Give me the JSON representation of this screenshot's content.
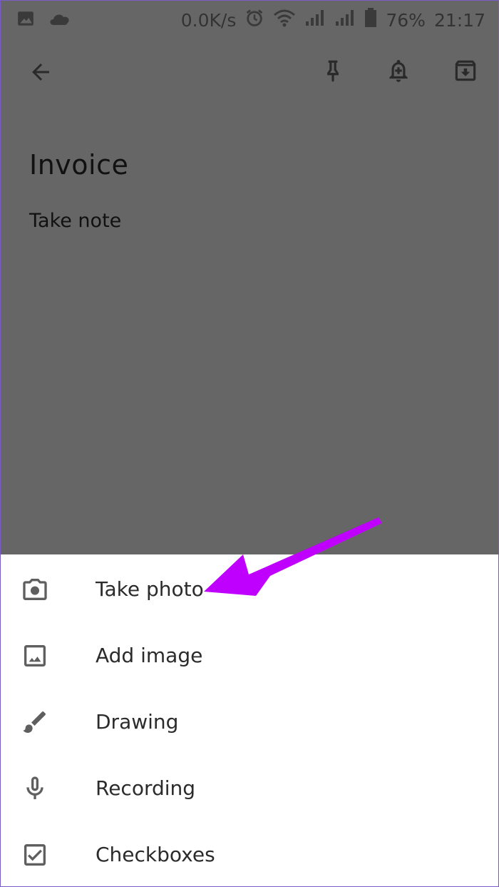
{
  "status_bar": {
    "network_speed": "0.0K/s",
    "battery": "76%",
    "time": "21:17",
    "icons": [
      "image-icon",
      "cloud-icon",
      "alarm-icon",
      "wifi-icon",
      "signal-icon",
      "signal-icon-2",
      "battery-icon"
    ]
  },
  "app_bar": {
    "icons": [
      "back-arrow-icon",
      "pin-icon",
      "reminder-bell-icon",
      "archive-icon"
    ]
  },
  "note": {
    "title": "Invoice",
    "body_placeholder": "Take note"
  },
  "add_menu": {
    "items": [
      {
        "label": "Take photo",
        "icon": "camera-icon"
      },
      {
        "label": "Add image",
        "icon": "image-icon"
      },
      {
        "label": "Drawing",
        "icon": "brush-icon"
      },
      {
        "label": "Recording",
        "icon": "microphone-icon"
      },
      {
        "label": "Checkboxes",
        "icon": "checkbox-icon"
      }
    ]
  },
  "colors": {
    "overlay": "#666666",
    "annotation_arrow": "#c000ff",
    "icon_gray": "#5f5f5f"
  }
}
